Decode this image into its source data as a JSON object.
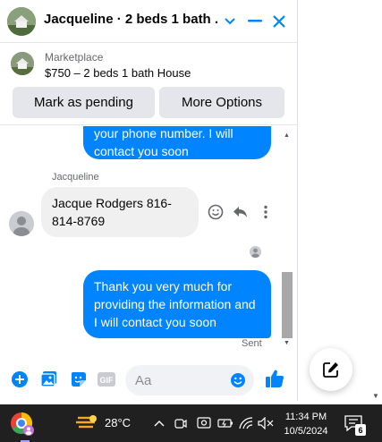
{
  "header": {
    "title": "Jacqueline · 2 beds 1 bath ..."
  },
  "listing": {
    "kind": "Marketplace",
    "description": "$750 – 2 beds 1 bath House",
    "mark_pending_label": "Mark as pending",
    "more_options_label": "More Options"
  },
  "messages": {
    "first_outgoing_partial": "your phone number. I will contact you soon",
    "sender_name": "Jacqueline",
    "incoming_text": "Jacque Rodgers 816-814-8769",
    "outgoing_text": "Thank you very much for providing the information and I will contact you soon",
    "status": "Sent"
  },
  "composer": {
    "placeholder": "Aa"
  },
  "taskbar": {
    "temperature": "28°C",
    "time": "11:34 PM",
    "date": "10/5/2024",
    "notification_count": "6"
  },
  "colors": {
    "accent": "#0084ff",
    "taskbar": "#202020",
    "outgoing_bubble": "#0084ff",
    "incoming_bubble": "#f0f0f0"
  }
}
